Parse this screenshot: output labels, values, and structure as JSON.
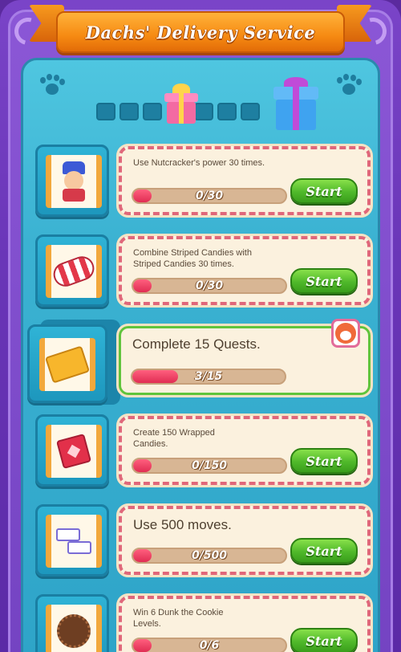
{
  "header": {
    "title": "Dachs' Delivery Service"
  },
  "progress": {
    "slots_total": 7,
    "gift_small_icon": "gift-icon",
    "gift_big_icon": "big-gift-icon"
  },
  "quests": [
    {
      "icon": "nutcracker-icon",
      "text": "Use Nutcracker's power 30 times.",
      "progress_label": "0/30",
      "progress": 0,
      "button": "Start",
      "active": false
    },
    {
      "icon": "striped-candy-icon",
      "text": "Combine Striped Candies with Striped Candies 30 times.",
      "progress_label": "0/30",
      "progress": 0,
      "button": "Start",
      "active": false
    },
    {
      "icon": "map-scroll-icon",
      "text": "Complete 15 Quests.",
      "progress_label": "3/15",
      "progress": 0.2,
      "active": true,
      "badge_icon": "fox-avatar-icon"
    },
    {
      "icon": "wrapped-candy-icon",
      "text": "Create 150 Wrapped Candies.",
      "progress_label": "0/150",
      "progress": 0,
      "button": "Start",
      "active": false
    },
    {
      "icon": "swap-moves-icon",
      "text": "Use 500 moves.",
      "progress_label": "0/500",
      "progress": 0,
      "button": "Start",
      "active": false
    },
    {
      "icon": "cookie-icon",
      "text": "Win 6 Dunk the Cookie Levels.",
      "progress_label": "0/6",
      "progress": 0,
      "button": "Start",
      "active": false
    }
  ],
  "colors": {
    "frame": "#7443c2",
    "panel": "#3bb2d2",
    "ribbon": "#f68a12",
    "start_button": "#4fb82a",
    "bar_fill": "#e02d53"
  }
}
